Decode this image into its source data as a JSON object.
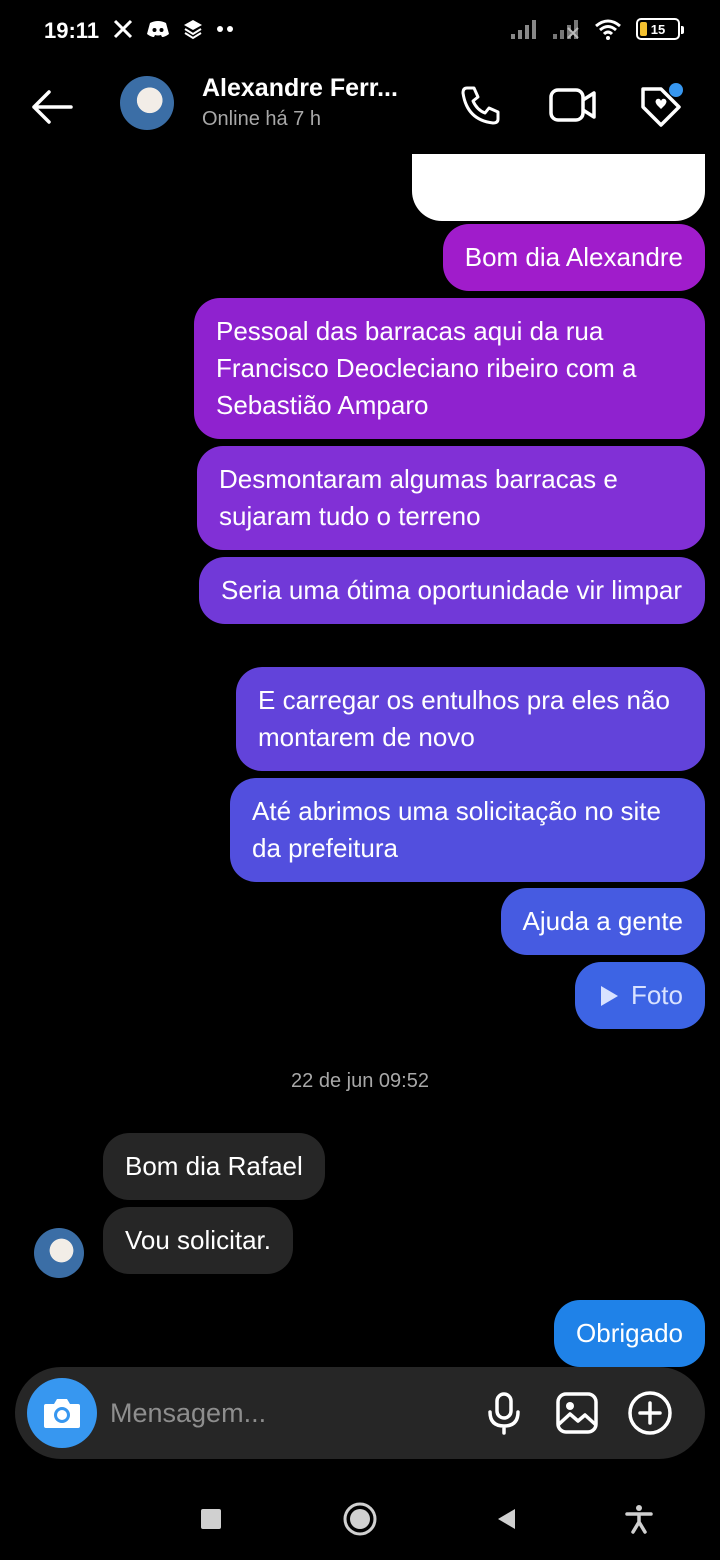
{
  "status_bar": {
    "time": "19:11",
    "battery": "15",
    "left_icons": [
      "x-icon",
      "discord-icon",
      "layers-icon",
      "more-dots-icon"
    ],
    "right_icons": [
      "signal-icon",
      "signal-no-service-icon",
      "wifi-icon",
      "battery-icon"
    ]
  },
  "header": {
    "name": "Alexandre Ferr...",
    "status": "Online há 7 h",
    "icons": [
      "back-arrow-icon",
      "phone-icon",
      "video-icon",
      "heart-tag-icon"
    ]
  },
  "messages": {
    "m1": "Bom dia Alexandre",
    "m2": "Pessoal das barracas aqui da rua Francisco Deocleciano ribeiro com a Sebastião Amparo",
    "m3": "Desmontaram algumas barracas e sujaram tudo o terreno",
    "m4": "Seria uma ótima oportunidade vir limpar",
    "m5": "E carregar os entulhos pra eles não montarem de novo",
    "m6": "Até abrimos uma solicitação no site da prefeitura",
    "m7": "Ajuda a gente",
    "m8": "Foto",
    "timestamp": "22 de jun 09:52",
    "in1": "Bom dia Rafael",
    "in2": "Vou solicitar.",
    "m9": "Obrigado"
  },
  "composer": {
    "placeholder": "Mensagem...",
    "icons": [
      "camera-icon",
      "microphone-icon",
      "gallery-icon",
      "add-circle-icon"
    ]
  },
  "colors": {
    "accent": "#3797f0",
    "gradient_top": "#a11ccc",
    "gradient_bottom": "#3a6ae6",
    "incoming": "#262626"
  }
}
